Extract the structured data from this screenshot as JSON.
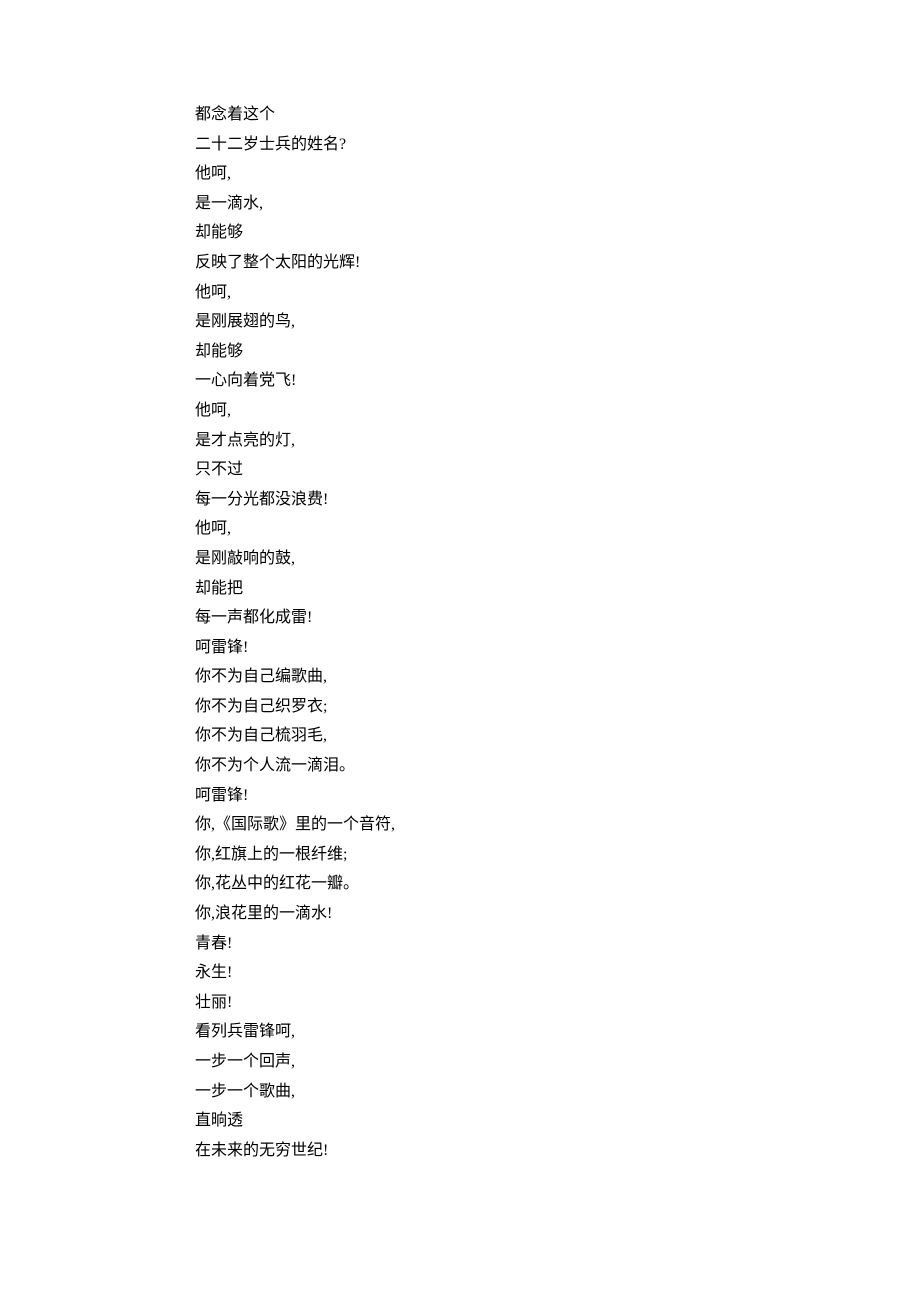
{
  "poem": {
    "lines": [
      "都念着这个",
      "二十二岁士兵的姓名?",
      "他呵,",
      "是一滴水,",
      "却能够",
      "反映了整个太阳的光辉!",
      "他呵,",
      "是刚展翅的鸟,",
      "却能够",
      "一心向着党飞!",
      "他呵,",
      "是才点亮的灯,",
      "只不过",
      "每一分光都没浪费!",
      "他呵,",
      "是刚敲响的鼓,",
      "却能把",
      "每一声都化成雷!",
      "呵雷锋!",
      "你不为自己编歌曲,",
      "你不为自己织罗衣;",
      "你不为自己梳羽毛,",
      "你不为个人流一滴泪。",
      "呵雷锋!",
      "你,《国际歌》里的一个音符,",
      "你,红旗上的一根纤维;",
      "你,花丛中的红花一瓣。",
      "你,浪花里的一滴水!",
      "青春!",
      "永生!",
      "壮丽!",
      "看列兵雷锋呵,",
      "一步一个回声,",
      "一步一个歌曲,",
      "直晌透",
      "在未来的无穷世纪!"
    ]
  }
}
